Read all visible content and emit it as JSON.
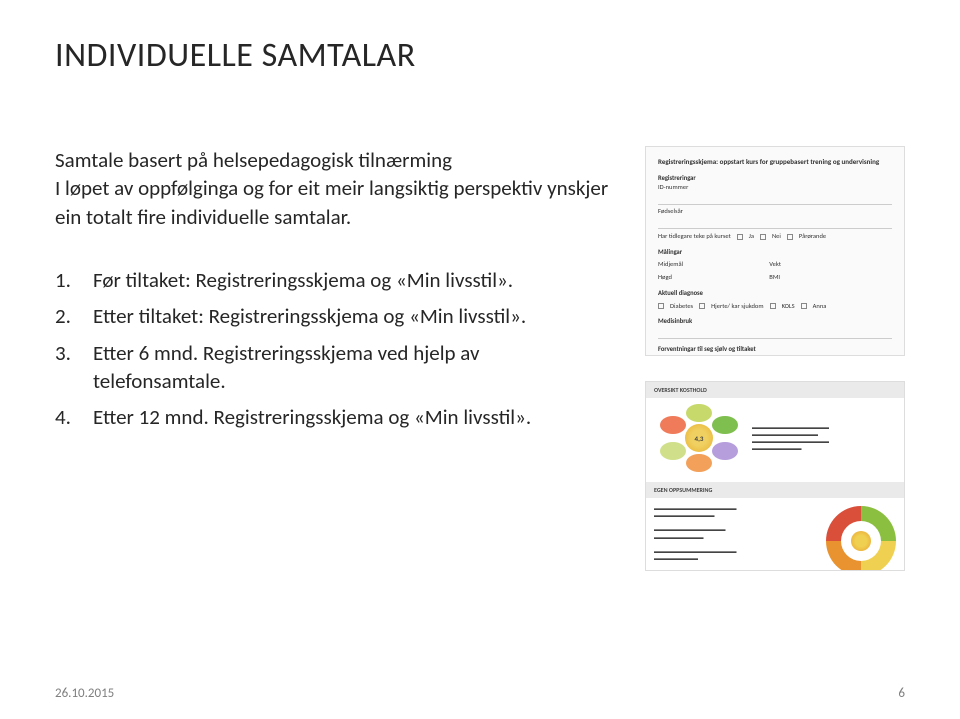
{
  "title": "INDIVIDUELLE SAMTALAR",
  "intro": "Samtale basert på helsepedagogisk tilnærming\nI løpet av oppfølginga og for eit meir langsiktig perspektiv ynskjer ein totalt fire individuelle samtalar.",
  "list": {
    "item1": "Før tiltaket: Registreringsskjema og «Min livsstil».",
    "item2": "Etter tiltaket: Registreringsskjema og «Min livsstil».",
    "item3": "Etter 6 mnd. Registreringsskjema ved hjelp av telefonsamtale.",
    "item4": "Etter 12 mnd. Registreringsskjema og «Min livsstil»."
  },
  "form_thumb": {
    "heading": "Registreringsskjema: oppstart kurs for gruppebasert trening og undervisning",
    "s1": "Registreringar",
    "f1": "ID-nummer",
    "f2": "Fødselsår",
    "f3": "Har tidlegare teke på kurset",
    "opt_ja": "Ja",
    "opt_nei": "Nei",
    "opt_par": "Pårørande",
    "s2": "Målingar",
    "m1": "Midjemål",
    "m2": "Vekt",
    "m3": "Høgd",
    "m4": "BMI",
    "s3": "Aktuell diagnose",
    "d1": "Diabetes",
    "d2": "Hjerte/ kar sjukdom",
    "d3": "KOLS",
    "d4": "Anna",
    "s4": "Medisinbruk",
    "s5": "Forventningar til seg sjølv og tiltaket"
  },
  "results_thumb": {
    "h1": "OVERSIKT KOSTHOLD",
    "score": "4,3",
    "h2": "EGEN OPPSUMMERING"
  },
  "footer": {
    "date": "26.10.2015",
    "page": "6"
  }
}
